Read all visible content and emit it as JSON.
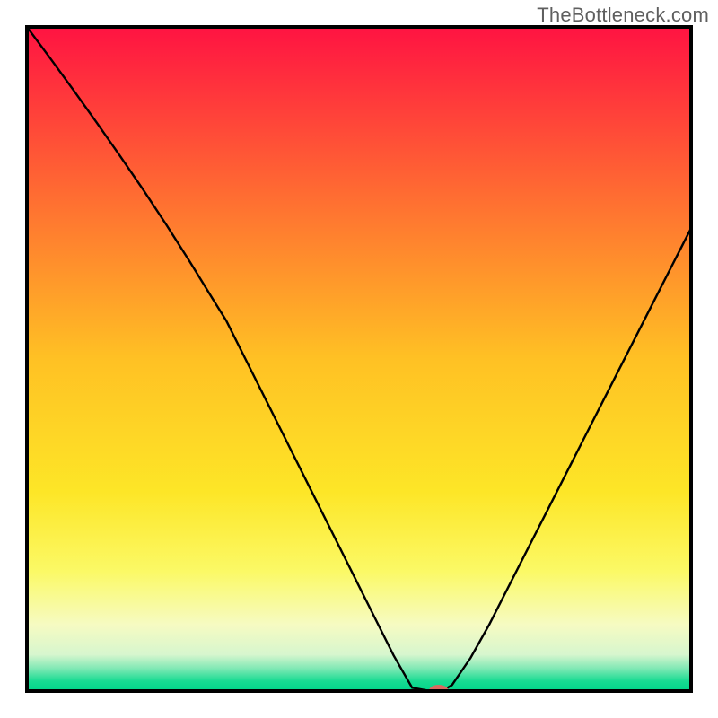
{
  "watermark": "TheBottleneck.com",
  "chart_data": {
    "type": "line",
    "title": "",
    "xlabel": "",
    "ylabel": "",
    "xlim": [
      0,
      100
    ],
    "ylim": [
      0,
      100
    ],
    "grid": false,
    "legend": false,
    "background_gradient": {
      "orientation": "vertical",
      "stops": [
        {
          "offset": 0.0,
          "color": "#ff1342"
        },
        {
          "offset": 0.25,
          "color": "#ff6b32"
        },
        {
          "offset": 0.5,
          "color": "#ffc124"
        },
        {
          "offset": 0.7,
          "color": "#fde627"
        },
        {
          "offset": 0.82,
          "color": "#fbf966"
        },
        {
          "offset": 0.9,
          "color": "#f6fbc2"
        },
        {
          "offset": 0.945,
          "color": "#d7f6ce"
        },
        {
          "offset": 0.965,
          "color": "#84e9b6"
        },
        {
          "offset": 0.985,
          "color": "#18db92"
        },
        {
          "offset": 1.0,
          "color": "#00d58a"
        }
      ]
    },
    "series": [
      {
        "name": "bottleneck-curve",
        "x": [
          0.0,
          3.5,
          7.0,
          10.5,
          14.0,
          17.5,
          21.0,
          24.5,
          28.0,
          30.0,
          32.8,
          35.6,
          38.4,
          41.2,
          44.0,
          46.8,
          49.6,
          52.4,
          55.2,
          58.0,
          60.8,
          62.5,
          64.0,
          66.8,
          69.6,
          72.4,
          75.2,
          78.0,
          80.8,
          83.6,
          86.4,
          89.2,
          92.0,
          94.8,
          97.6,
          100.0
        ],
        "y": [
          100.0,
          95.3,
          90.5,
          85.6,
          80.6,
          75.5,
          70.2,
          64.7,
          59.0,
          55.8,
          50.2,
          44.6,
          39.0,
          33.4,
          27.8,
          22.2,
          16.6,
          11.0,
          5.4,
          0.5,
          0.0,
          0.0,
          0.9,
          5.0,
          10.0,
          15.5,
          21.0,
          26.5,
          32.0,
          37.5,
          43.0,
          48.5,
          54.0,
          59.5,
          65.0,
          69.7
        ]
      }
    ],
    "marker": {
      "name": "optimal-point",
      "x": 62.0,
      "y": 0.0,
      "color": "#d86a60",
      "rx": 11,
      "ry": 7
    },
    "frame": {
      "stroke": "#000000",
      "stroke_width": 4
    }
  }
}
